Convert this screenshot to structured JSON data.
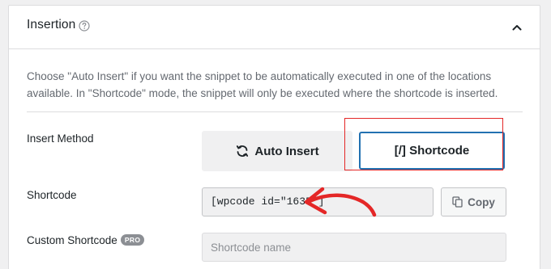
{
  "section": {
    "title": "Insertion",
    "description": "Choose \"Auto Insert\" if you want the snippet to be automatically executed in one of the locations available. In \"Shortcode\" mode, the snippet will only be executed where the shortcode is inserted."
  },
  "insert_method": {
    "label": "Insert Method",
    "auto_label": "Auto Insert",
    "shortcode_label": "[/] Shortcode",
    "selected": "Shortcode"
  },
  "shortcode": {
    "label": "Shortcode",
    "value": "[wpcode id=\"1635\"]",
    "copy_label": "Copy"
  },
  "custom_shortcode": {
    "label": "Custom Shortcode",
    "badge": "PRO",
    "placeholder": "Shortcode name"
  },
  "colors": {
    "accent": "#2271b1",
    "annotation": "#e42727"
  },
  "icons": {
    "help": "help-circle-icon",
    "collapse": "chevron-up-icon",
    "auto_insert": "refresh-icon",
    "copy": "copy-icon"
  }
}
